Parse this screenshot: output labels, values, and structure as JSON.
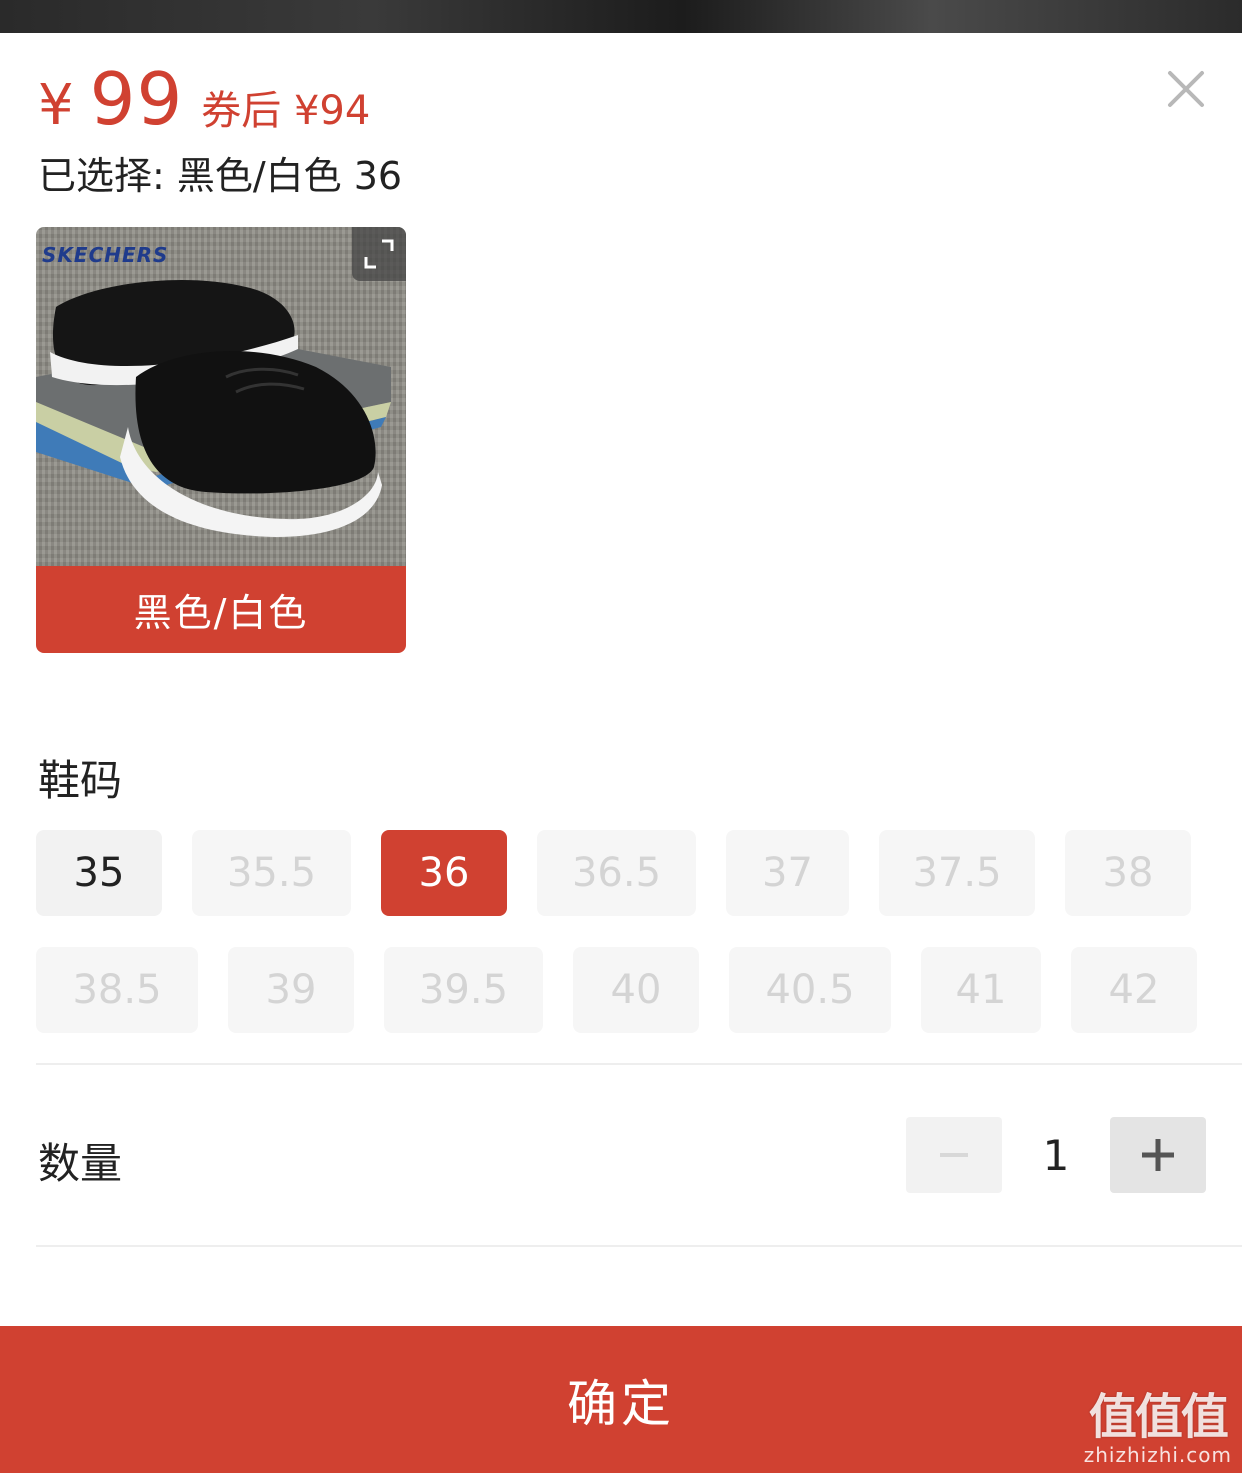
{
  "price": {
    "symbol": "¥",
    "value": "99",
    "coupon_text": "券后 ¥94"
  },
  "selection": {
    "label": "已选择:",
    "value": "黑色/白色 36"
  },
  "variants": [
    {
      "brand_logo": "SKECHERS",
      "label": "黑色/白色",
      "selected": true
    }
  ],
  "size_section": {
    "title": "鞋码",
    "sizes": [
      {
        "label": "35",
        "state": "available"
      },
      {
        "label": "35.5",
        "state": "unavailable"
      },
      {
        "label": "36",
        "state": "selected"
      },
      {
        "label": "36.5",
        "state": "unavailable"
      },
      {
        "label": "37",
        "state": "unavailable"
      },
      {
        "label": "37.5",
        "state": "unavailable"
      },
      {
        "label": "38",
        "state": "unavailable"
      },
      {
        "label": "38.5",
        "state": "unavailable"
      },
      {
        "label": "39",
        "state": "unavailable"
      },
      {
        "label": "39.5",
        "state": "unavailable"
      },
      {
        "label": "40",
        "state": "unavailable"
      },
      {
        "label": "40.5",
        "state": "unavailable"
      },
      {
        "label": "41",
        "state": "unavailable"
      },
      {
        "label": "42",
        "state": "unavailable"
      }
    ]
  },
  "quantity": {
    "title": "数量",
    "value": "1",
    "minus_icon": "minus-icon",
    "plus_icon": "plus-icon"
  },
  "confirm": {
    "label": "确定"
  },
  "watermark": {
    "logo": "值值值",
    "url": "zhizhizhi.com"
  },
  "colors": {
    "accent": "#d04131",
    "selected_bg": "#d04131",
    "available_bg": "#f2f2f2",
    "disabled_text": "#d4d4d4"
  },
  "icons": {
    "close": "close-icon",
    "expand": "expand-icon"
  }
}
